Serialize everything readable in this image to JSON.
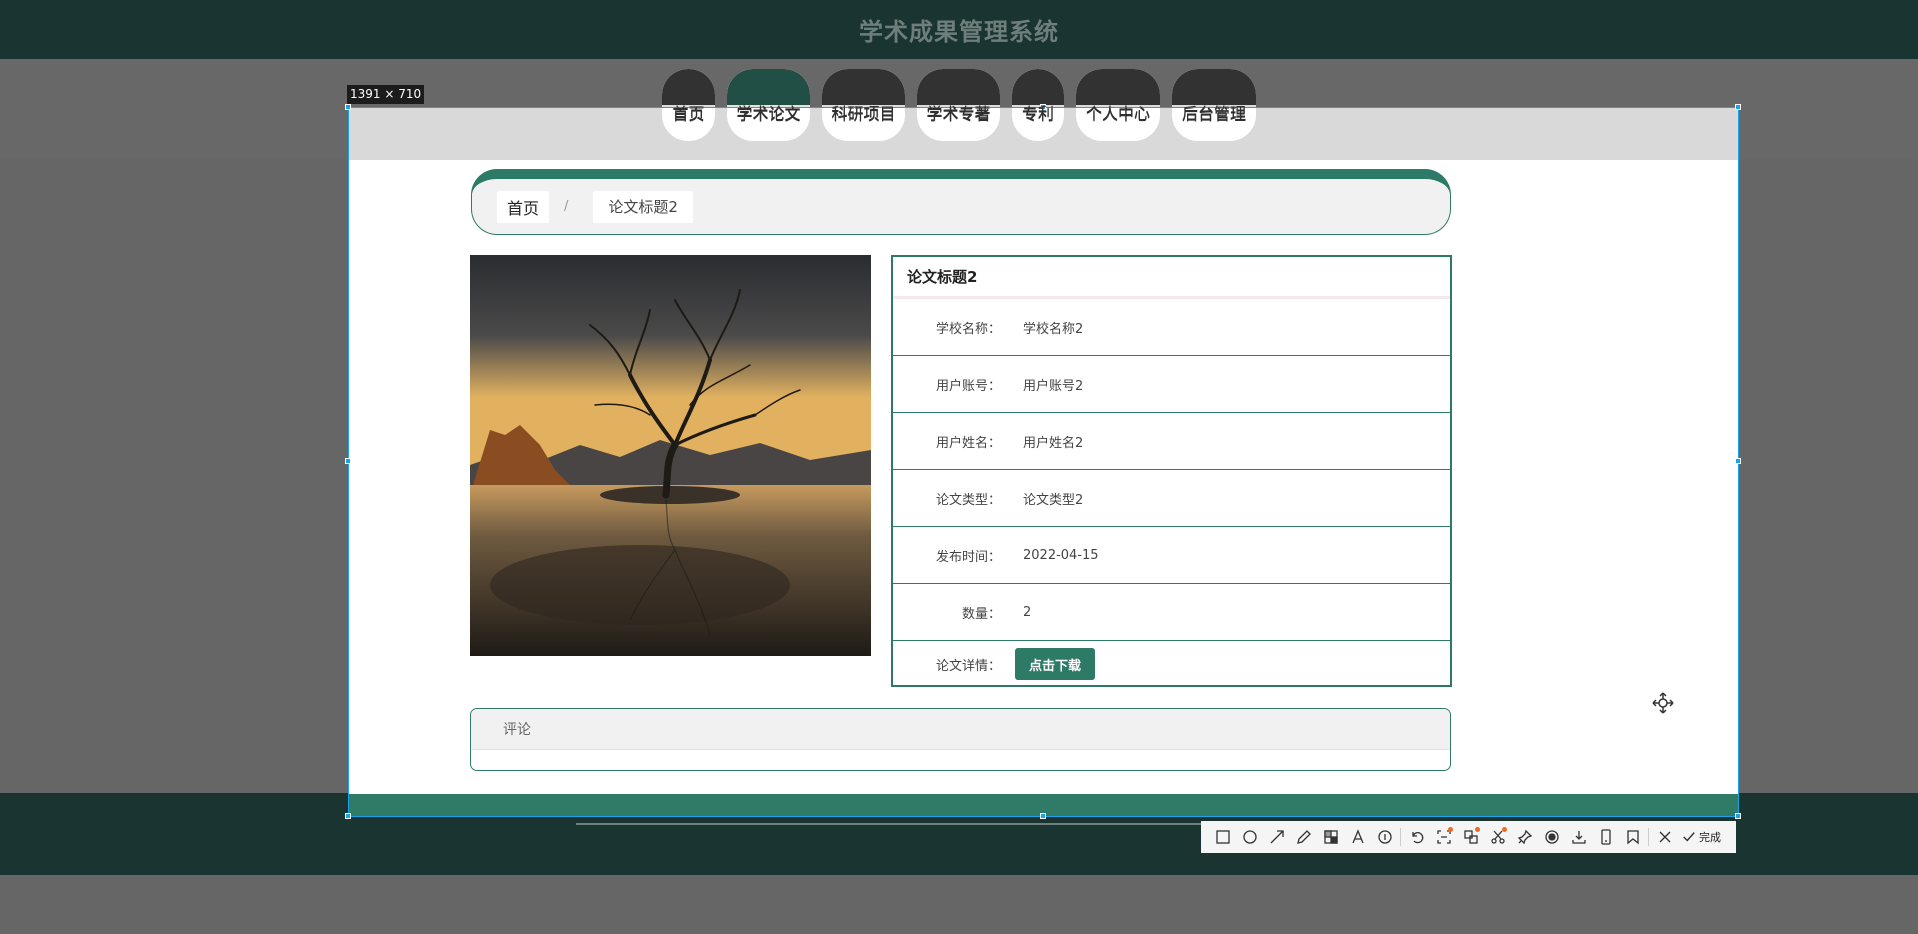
{
  "app": {
    "title": "学术成果管理系统"
  },
  "nav": {
    "items": [
      {
        "label": "首页",
        "active": false
      },
      {
        "label": "学术论文",
        "active": true
      },
      {
        "label": "科研项目",
        "active": false
      },
      {
        "label": "学术专著",
        "active": false
      },
      {
        "label": "专利",
        "active": false
      },
      {
        "label": "个人中心",
        "active": false
      },
      {
        "label": "后台管理",
        "active": false
      }
    ]
  },
  "capture": {
    "size_label": "1391 × 710"
  },
  "breadcrumb": {
    "home": "首页",
    "separator": "/",
    "current": "论文标题2"
  },
  "detail": {
    "title": "论文标题2",
    "rows": [
      {
        "label": "学校名称：",
        "value": "学校名称2"
      },
      {
        "label": "用户账号：",
        "value": "用户账号2"
      },
      {
        "label": "用户姓名：",
        "value": "用户姓名2"
      },
      {
        "label": "论文类型：",
        "value": "论文类型2"
      },
      {
        "label": "发布时间：",
        "value": "2022-04-15"
      },
      {
        "label": "数量：",
        "value": "2"
      }
    ],
    "download_label": "论文详情：",
    "download_button": "点击下载"
  },
  "comment": {
    "title": "评论"
  },
  "toolbar": {
    "icons": [
      "rectangle-icon",
      "ellipse-icon",
      "arrow-icon",
      "pencil-icon",
      "mosaic-icon",
      "text-icon",
      "number-icon",
      "undo-icon",
      "ocr-icon",
      "translate-icon",
      "scissors-icon",
      "pin-icon",
      "record-icon",
      "download-icon",
      "long-screenshot-icon",
      "bookmark-icon",
      "close-icon"
    ],
    "done_label": "完成",
    "badge_color": "#f06a25"
  },
  "colors": {
    "accent": "#2d7a67",
    "header": "#1a3431",
    "selection": "#1aa3e8"
  }
}
